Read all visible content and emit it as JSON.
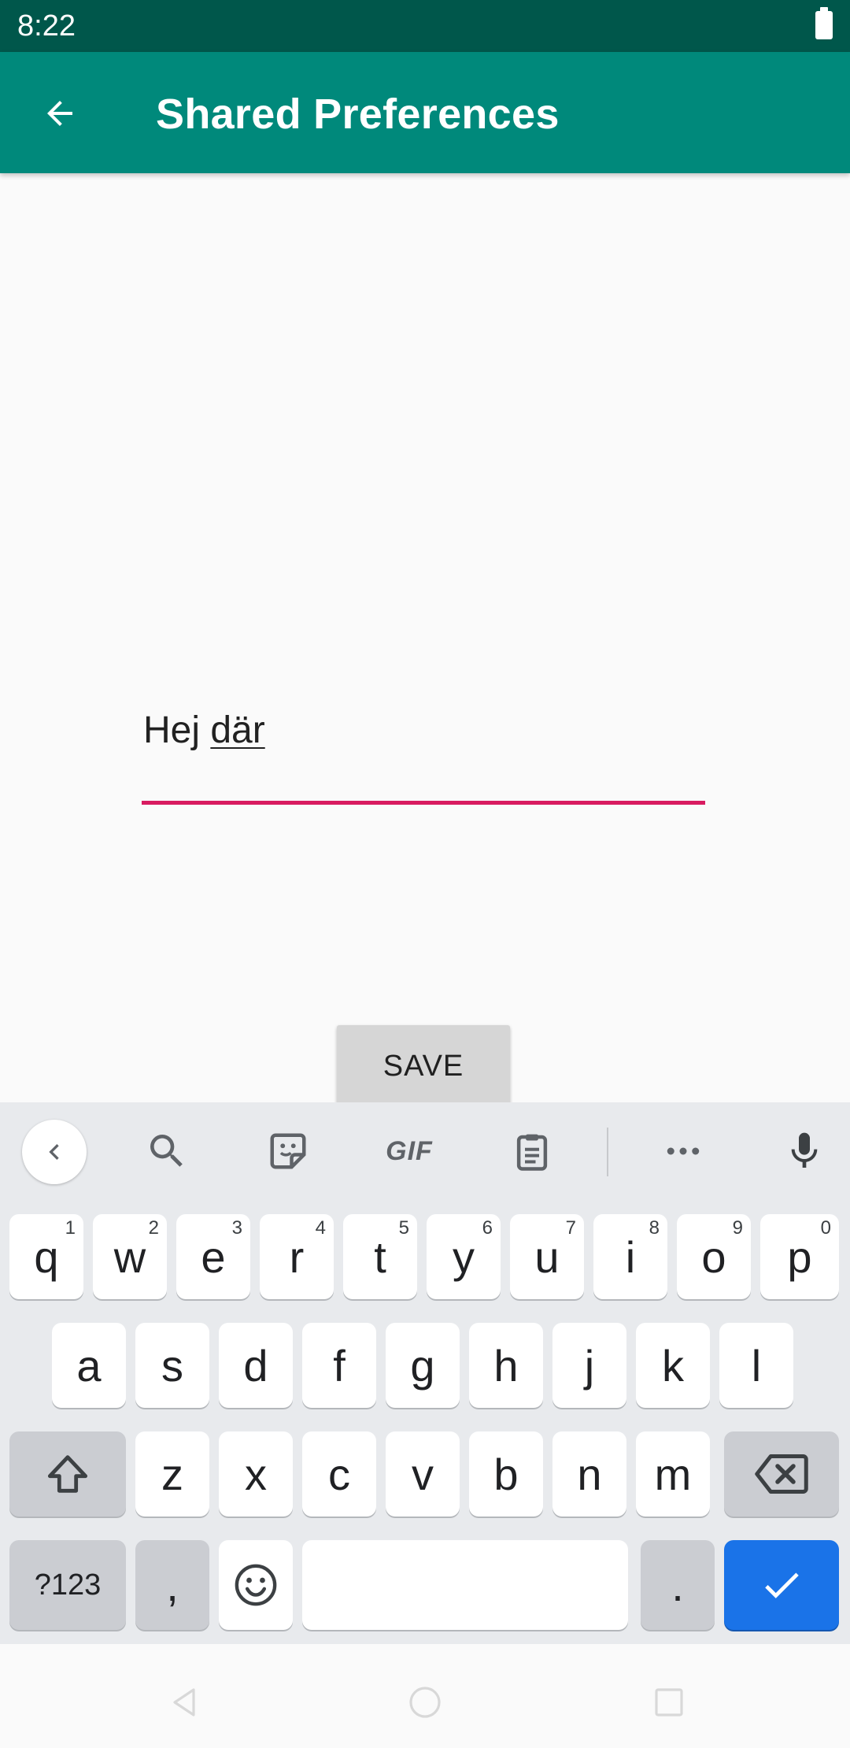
{
  "status_bar": {
    "time": "8:22",
    "battery_icon": "battery-full-icon"
  },
  "app_bar": {
    "title": "Shared Preferences",
    "back_icon": "arrow-back-icon",
    "color": "#00897b",
    "status_color": "#00574b"
  },
  "form": {
    "input_text": "Hej ",
    "input_composing": "där",
    "underline_color": "#d81b60",
    "save_label": "SAVE"
  },
  "keyboard": {
    "toolbar": [
      "collapse-icon",
      "search-icon",
      "sticker-icon",
      "gif-icon",
      "clipboard-icon",
      "more-icon",
      "mic-icon"
    ],
    "gif_label": "GIF",
    "row1": [
      {
        "key": "q",
        "hint": "1"
      },
      {
        "key": "w",
        "hint": "2"
      },
      {
        "key": "e",
        "hint": "3"
      },
      {
        "key": "r",
        "hint": "4"
      },
      {
        "key": "t",
        "hint": "5"
      },
      {
        "key": "y",
        "hint": "6"
      },
      {
        "key": "u",
        "hint": "7"
      },
      {
        "key": "i",
        "hint": "8"
      },
      {
        "key": "o",
        "hint": "9"
      },
      {
        "key": "p",
        "hint": "0"
      }
    ],
    "row2": [
      "a",
      "s",
      "d",
      "f",
      "g",
      "h",
      "j",
      "k",
      "l"
    ],
    "row3": [
      "z",
      "x",
      "c",
      "v",
      "b",
      "n",
      "m"
    ],
    "symbols_label": "?123",
    "comma": ",",
    "period": ".",
    "enter_color": "#1a73e8"
  },
  "nav_bar": [
    "nav-back-icon",
    "nav-home-icon",
    "nav-recents-icon"
  ]
}
